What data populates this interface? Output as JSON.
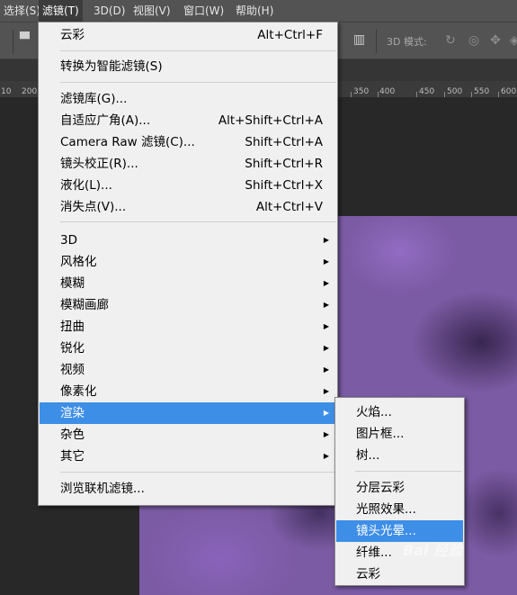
{
  "menubar": {
    "items": [
      {
        "label": "选择(S)"
      },
      {
        "label": "滤镜(T)"
      },
      {
        "label": "3D(D)"
      },
      {
        "label": "视图(V)"
      },
      {
        "label": "窗口(W)"
      },
      {
        "label": "帮助(H)"
      }
    ],
    "active_index": 1
  },
  "options_bar": {
    "mode_label": "3D 模式:"
  },
  "ruler": {
    "ticks": [
      "10",
      "200",
      "350",
      "400",
      "450",
      "500",
      "550",
      "600"
    ]
  },
  "filter_menu": {
    "last_filter": {
      "label": "云彩",
      "shortcut": "Alt+Ctrl+F"
    },
    "convert_smart": {
      "label": "转换为智能滤镜(S)"
    },
    "group_editors": [
      {
        "label": "滤镜库(G)...",
        "shortcut": ""
      },
      {
        "label": "自适应广角(A)...",
        "shortcut": "Alt+Shift+Ctrl+A"
      },
      {
        "label": "Camera Raw 滤镜(C)...",
        "shortcut": "Shift+Ctrl+A"
      },
      {
        "label": "镜头校正(R)...",
        "shortcut": "Shift+Ctrl+R"
      },
      {
        "label": "液化(L)...",
        "shortcut": "Shift+Ctrl+X"
      },
      {
        "label": "消失点(V)...",
        "shortcut": "Alt+Ctrl+V"
      }
    ],
    "group_submenus": [
      {
        "label": "3D"
      },
      {
        "label": "风格化"
      },
      {
        "label": "模糊"
      },
      {
        "label": "模糊画廊"
      },
      {
        "label": "扭曲"
      },
      {
        "label": "锐化"
      },
      {
        "label": "视频"
      },
      {
        "label": "像素化"
      },
      {
        "label": "渲染"
      },
      {
        "label": "杂色"
      },
      {
        "label": "其它"
      }
    ],
    "highlighted": "渲染",
    "browse_online": {
      "label": "浏览联机滤镜..."
    }
  },
  "render_submenu": {
    "items_top": [
      "火焰...",
      "图片框...",
      "树..."
    ],
    "items_bottom": [
      "分层云彩",
      "光照效果...",
      "镜头光晕...",
      "纤维...",
      "云彩"
    ],
    "highlighted": "镜头光晕..."
  },
  "colors": {
    "highlight": "#3d8ee6",
    "menu_bg": "#f0f0f0",
    "canvas_purple": "#7b5ba3"
  },
  "watermark": {
    "text": "Bai 经验"
  }
}
